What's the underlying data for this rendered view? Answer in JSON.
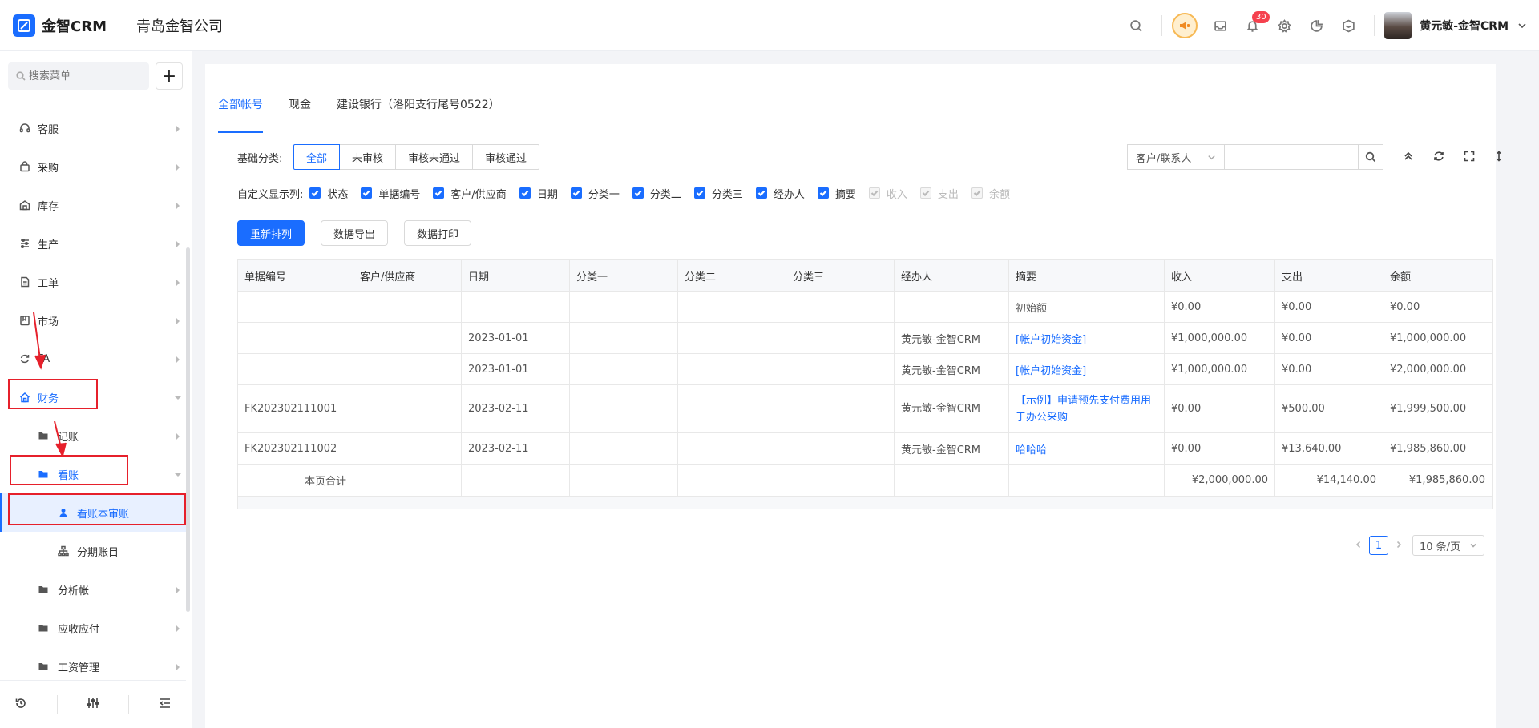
{
  "header": {
    "brand": "金智CRM",
    "company": "青岛金智公司",
    "notification_count": "30",
    "user_name": "黄元敏-金智CRM",
    "accent": "#1a6dff"
  },
  "sidebar": {
    "search_placeholder": "搜索菜单",
    "items": [
      {
        "label": "客服"
      },
      {
        "label": "采购"
      },
      {
        "label": "库存"
      },
      {
        "label": "生产"
      },
      {
        "label": "工单"
      },
      {
        "label": "市场"
      },
      {
        "label": "FA"
      },
      {
        "label": "财务"
      },
      {
        "label": "记账"
      },
      {
        "label": "看账"
      },
      {
        "label": "看账本审账"
      },
      {
        "label": "分期账目"
      },
      {
        "label": "分析帐"
      },
      {
        "label": "应收应付"
      },
      {
        "label": "工资管理"
      }
    ]
  },
  "tabs": [
    "全部帐号",
    "现金",
    "建设银行（洛阳支行尾号0522）"
  ],
  "filter": {
    "label": "基础分类:",
    "options": [
      "全部",
      "未审核",
      "审核未通过",
      "审核通过"
    ],
    "selected": "全部"
  },
  "search": {
    "select_value": "客户/联系人"
  },
  "columns_toggle": {
    "label": "自定义显示列:",
    "items": [
      {
        "label": "状态",
        "checked": true,
        "disabled": false
      },
      {
        "label": "单据编号",
        "checked": true,
        "disabled": false
      },
      {
        "label": "客户/供应商",
        "checked": true,
        "disabled": false
      },
      {
        "label": "日期",
        "checked": true,
        "disabled": false
      },
      {
        "label": "分类一",
        "checked": true,
        "disabled": false
      },
      {
        "label": "分类二",
        "checked": true,
        "disabled": false
      },
      {
        "label": "分类三",
        "checked": true,
        "disabled": false
      },
      {
        "label": "经办人",
        "checked": true,
        "disabled": false
      },
      {
        "label": "摘要",
        "checked": true,
        "disabled": false
      },
      {
        "label": "收入",
        "checked": true,
        "disabled": true
      },
      {
        "label": "支出",
        "checked": true,
        "disabled": true
      },
      {
        "label": "余额",
        "checked": true,
        "disabled": true
      }
    ]
  },
  "actions": {
    "reorder": "重新排列",
    "export": "数据导出",
    "print": "数据打印"
  },
  "table": {
    "headers": [
      "单据编号",
      "客户/供应商",
      "日期",
      "分类一",
      "分类二",
      "分类三",
      "经办人",
      "摘要",
      "收入",
      "支出",
      "余额"
    ],
    "rows": [
      [
        "",
        "",
        "",
        "",
        "",
        "",
        "",
        "初始额",
        "¥0.00",
        "¥0.00",
        "¥0.00"
      ],
      [
        "",
        "",
        "2023-01-01",
        "",
        "",
        "",
        "黄元敏-金智CRM",
        "[帐户初始资金]",
        "¥1,000,000.00",
        "¥0.00",
        "¥1,000,000.00"
      ],
      [
        "",
        "",
        "2023-01-01",
        "",
        "",
        "",
        "黄元敏-金智CRM",
        "[帐户初始资金]",
        "¥1,000,000.00",
        "¥0.00",
        "¥2,000,000.00"
      ],
      [
        "FK202302111001",
        "",
        "2023-02-11",
        "",
        "",
        "",
        "黄元敏-金智CRM",
        "【示例】申请预先支付费用用于办公采购",
        "¥0.00",
        "¥500.00",
        "¥1,999,500.00"
      ],
      [
        "FK202302111002",
        "",
        "2023-02-11",
        "",
        "",
        "",
        "黄元敏-金智CRM",
        "哈哈哈",
        "¥0.00",
        "¥13,640.00",
        "¥1,985,860.00"
      ]
    ],
    "summary": {
      "label": "本页合计",
      "income": "¥2,000,000.00",
      "expense": "¥14,140.00",
      "balance": "¥1,985,860.00"
    }
  },
  "pagination": {
    "current": "1",
    "page_size": "10 条/页"
  }
}
